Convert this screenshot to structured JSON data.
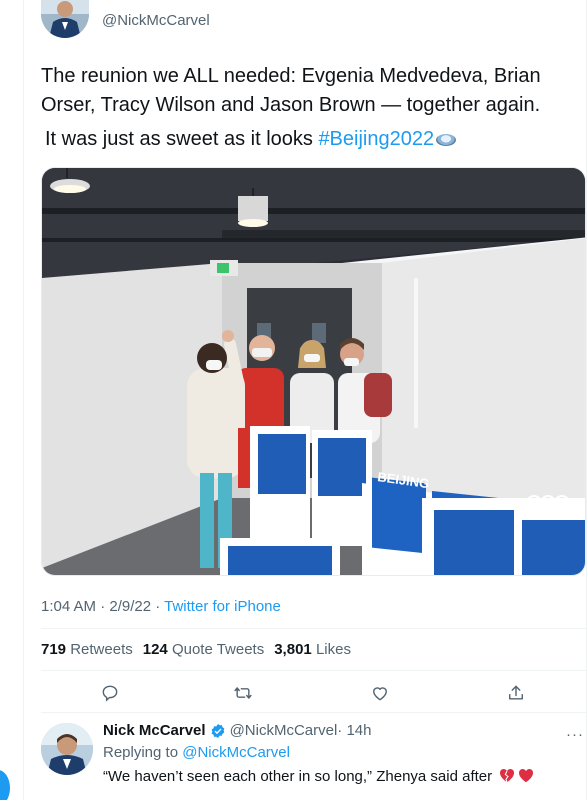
{
  "tweet": {
    "handle": "@NickMcCarvel",
    "text_line1": "The reunion we ALL needed: Evgenia Medvedeva, Brian Orser, Tracy Wilson and Jason Brown — together again.",
    "text_line2_prefix": "It was just as sweet as it looks ",
    "hashtag": "#Beijing2022",
    "hashtag_emoji": "beijing-2022-plate-emoji",
    "photo_sign_text": "BEIJING",
    "timestamp": "1:04 AM · 2/9/22 · ",
    "source": "Twitter for iPhone"
  },
  "stats": {
    "retweets_count": "719",
    "retweets_label": "Retweets",
    "quotes_count": "124",
    "quotes_label": "Quote Tweets",
    "likes_count": "3,801",
    "likes_label": "Likes"
  },
  "actions": [
    "reply-icon",
    "retweet-icon",
    "like-icon",
    "share-icon"
  ],
  "reply": {
    "name": "Nick McCarvel",
    "handle": "@NickMcCarvel",
    "time": " · 14h",
    "more": "···",
    "replying_prefix": "Replying to ",
    "replying_mention": "@NickMcCarvel",
    "text": "“We haven’t seen each other in so long,” Zhenya said after ",
    "emojis": [
      "broken-heart-emoji",
      "red-heart-emoji"
    ]
  },
  "colors": {
    "accent": "#1d9bf0",
    "text": "#0f1419",
    "secondary": "#536471",
    "divider": "#eff3f4"
  }
}
